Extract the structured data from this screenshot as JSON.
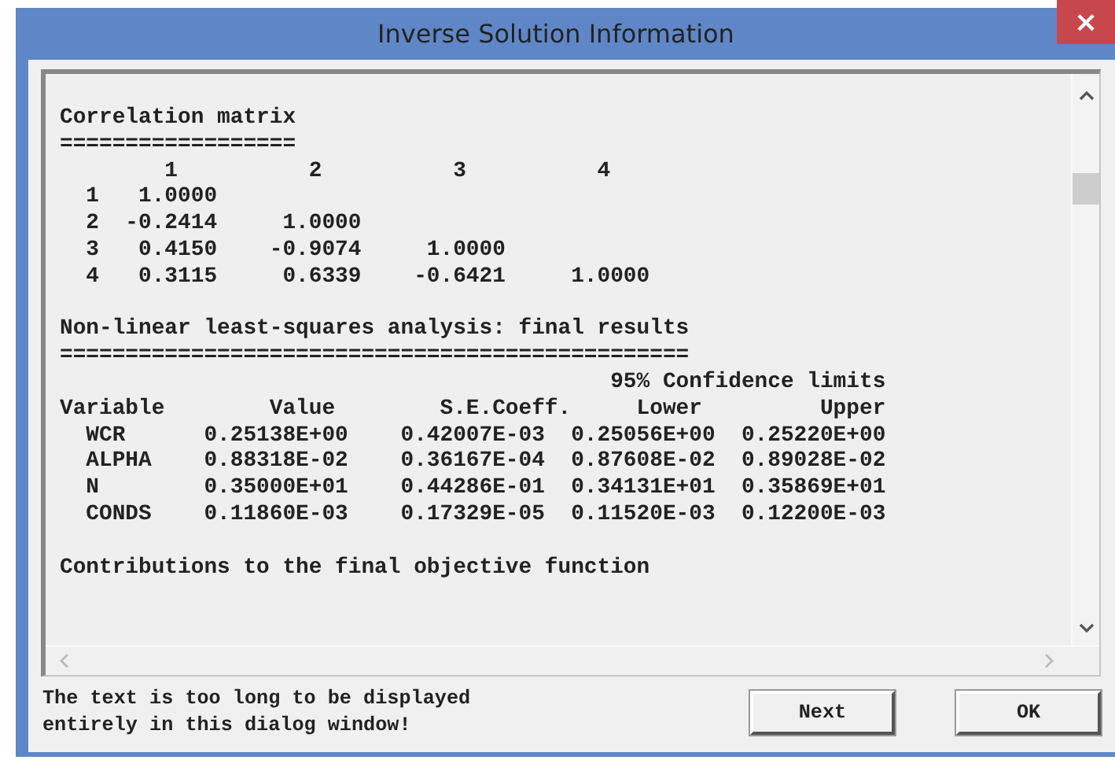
{
  "window": {
    "title": "Inverse Solution Information",
    "close": "×"
  },
  "report": {
    "blocks": [
      {
        "kind": "section",
        "lines": [
          "Correlation matrix",
          "==================",
          "        1          2          3          4",
          "  1   1.0000",
          "  2  -0.2414     1.0000",
          "  3   0.4150    -0.9074     1.0000",
          "  4   0.3115     0.6339    -0.6421     1.0000"
        ]
      },
      {
        "kind": "section",
        "lines": [
          "Non-linear least-squares analysis: final results",
          "================================================",
          "                                          95% Confidence limits",
          "Variable        Value        S.E.Coeff.     Lower         Upper",
          "  WCR      0.25138E+00    0.42007E-03  0.25056E+00  0.25220E+00",
          "  ALPHA    0.88318E-02    0.36167E-04  0.87608E-02  0.89028E-02",
          "  N        0.35000E+01    0.44286E-01  0.34131E+01  0.35869E+01",
          "  CONDS    0.11860E-03    0.17329E-05  0.11520E-03  0.12200E-03"
        ]
      },
      {
        "kind": "trailing",
        "lines": [
          "Contributions to the final objective function"
        ]
      }
    ]
  },
  "message": [
    "The text is too long to be displayed",
    "entirely in this dialog window!"
  ],
  "buttons": [
    "Next",
    "OK"
  ]
}
